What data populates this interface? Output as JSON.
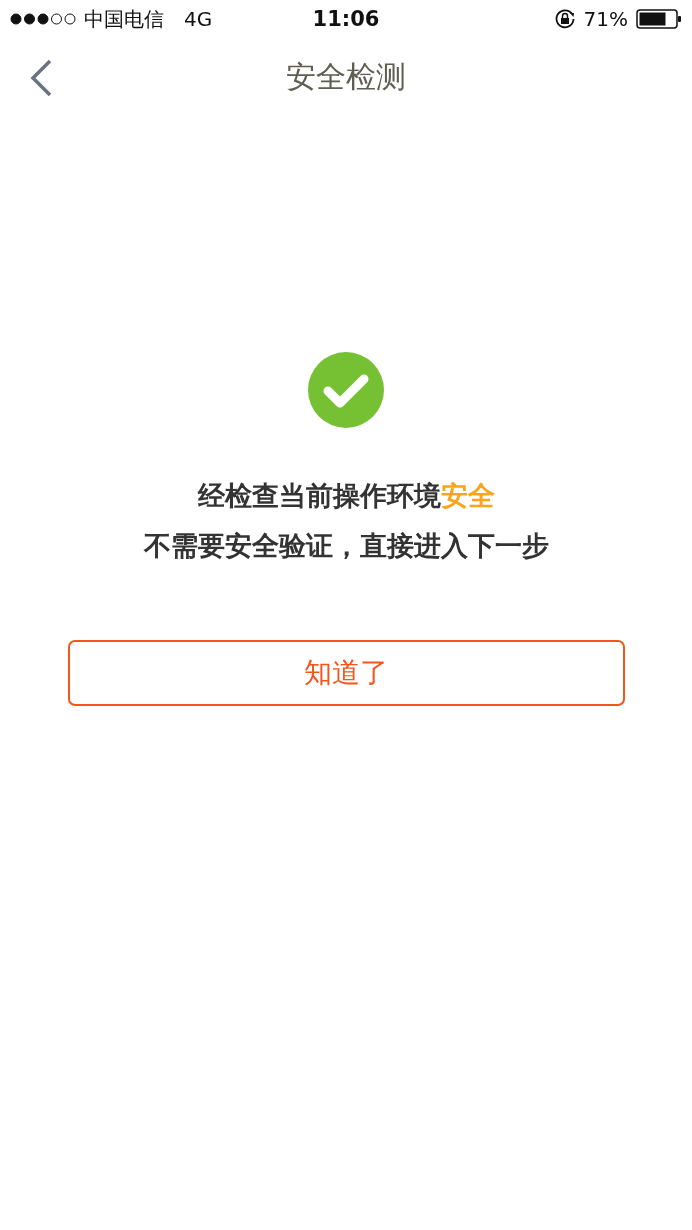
{
  "status_bar": {
    "carrier": "中国电信",
    "network": "4G",
    "time": "11:06",
    "battery": "71%"
  },
  "nav": {
    "title": "安全检测"
  },
  "result": {
    "line_1": {
      "text": "经检查当前操作环境",
      "highlight": "安全"
    },
    "line_2": "不需要安全验证，直接进入下一步"
  },
  "button": {
    "label": "知道了"
  }
}
